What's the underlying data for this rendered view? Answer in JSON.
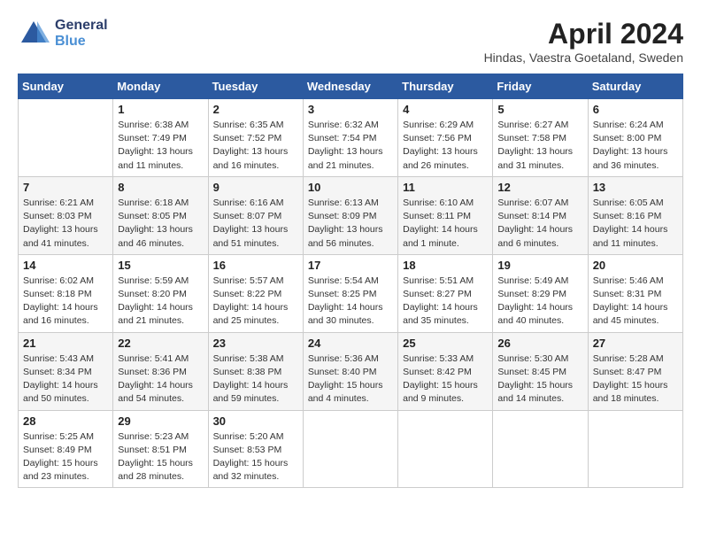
{
  "header": {
    "logo_line1": "General",
    "logo_line2": "Blue",
    "title": "April 2024",
    "location": "Hindas, Vaestra Goetaland, Sweden"
  },
  "weekdays": [
    "Sunday",
    "Monday",
    "Tuesday",
    "Wednesday",
    "Thursday",
    "Friday",
    "Saturday"
  ],
  "weeks": [
    [
      {
        "day": "",
        "info": ""
      },
      {
        "day": "1",
        "info": "Sunrise: 6:38 AM\nSunset: 7:49 PM\nDaylight: 13 hours\nand 11 minutes."
      },
      {
        "day": "2",
        "info": "Sunrise: 6:35 AM\nSunset: 7:52 PM\nDaylight: 13 hours\nand 16 minutes."
      },
      {
        "day": "3",
        "info": "Sunrise: 6:32 AM\nSunset: 7:54 PM\nDaylight: 13 hours\nand 21 minutes."
      },
      {
        "day": "4",
        "info": "Sunrise: 6:29 AM\nSunset: 7:56 PM\nDaylight: 13 hours\nand 26 minutes."
      },
      {
        "day": "5",
        "info": "Sunrise: 6:27 AM\nSunset: 7:58 PM\nDaylight: 13 hours\nand 31 minutes."
      },
      {
        "day": "6",
        "info": "Sunrise: 6:24 AM\nSunset: 8:00 PM\nDaylight: 13 hours\nand 36 minutes."
      }
    ],
    [
      {
        "day": "7",
        "info": "Sunrise: 6:21 AM\nSunset: 8:03 PM\nDaylight: 13 hours\nand 41 minutes."
      },
      {
        "day": "8",
        "info": "Sunrise: 6:18 AM\nSunset: 8:05 PM\nDaylight: 13 hours\nand 46 minutes."
      },
      {
        "day": "9",
        "info": "Sunrise: 6:16 AM\nSunset: 8:07 PM\nDaylight: 13 hours\nand 51 minutes."
      },
      {
        "day": "10",
        "info": "Sunrise: 6:13 AM\nSunset: 8:09 PM\nDaylight: 13 hours\nand 56 minutes."
      },
      {
        "day": "11",
        "info": "Sunrise: 6:10 AM\nSunset: 8:11 PM\nDaylight: 14 hours\nand 1 minute."
      },
      {
        "day": "12",
        "info": "Sunrise: 6:07 AM\nSunset: 8:14 PM\nDaylight: 14 hours\nand 6 minutes."
      },
      {
        "day": "13",
        "info": "Sunrise: 6:05 AM\nSunset: 8:16 PM\nDaylight: 14 hours\nand 11 minutes."
      }
    ],
    [
      {
        "day": "14",
        "info": "Sunrise: 6:02 AM\nSunset: 8:18 PM\nDaylight: 14 hours\nand 16 minutes."
      },
      {
        "day": "15",
        "info": "Sunrise: 5:59 AM\nSunset: 8:20 PM\nDaylight: 14 hours\nand 21 minutes."
      },
      {
        "day": "16",
        "info": "Sunrise: 5:57 AM\nSunset: 8:22 PM\nDaylight: 14 hours\nand 25 minutes."
      },
      {
        "day": "17",
        "info": "Sunrise: 5:54 AM\nSunset: 8:25 PM\nDaylight: 14 hours\nand 30 minutes."
      },
      {
        "day": "18",
        "info": "Sunrise: 5:51 AM\nSunset: 8:27 PM\nDaylight: 14 hours\nand 35 minutes."
      },
      {
        "day": "19",
        "info": "Sunrise: 5:49 AM\nSunset: 8:29 PM\nDaylight: 14 hours\nand 40 minutes."
      },
      {
        "day": "20",
        "info": "Sunrise: 5:46 AM\nSunset: 8:31 PM\nDaylight: 14 hours\nand 45 minutes."
      }
    ],
    [
      {
        "day": "21",
        "info": "Sunrise: 5:43 AM\nSunset: 8:34 PM\nDaylight: 14 hours\nand 50 minutes."
      },
      {
        "day": "22",
        "info": "Sunrise: 5:41 AM\nSunset: 8:36 PM\nDaylight: 14 hours\nand 54 minutes."
      },
      {
        "day": "23",
        "info": "Sunrise: 5:38 AM\nSunset: 8:38 PM\nDaylight: 14 hours\nand 59 minutes."
      },
      {
        "day": "24",
        "info": "Sunrise: 5:36 AM\nSunset: 8:40 PM\nDaylight: 15 hours\nand 4 minutes."
      },
      {
        "day": "25",
        "info": "Sunrise: 5:33 AM\nSunset: 8:42 PM\nDaylight: 15 hours\nand 9 minutes."
      },
      {
        "day": "26",
        "info": "Sunrise: 5:30 AM\nSunset: 8:45 PM\nDaylight: 15 hours\nand 14 minutes."
      },
      {
        "day": "27",
        "info": "Sunrise: 5:28 AM\nSunset: 8:47 PM\nDaylight: 15 hours\nand 18 minutes."
      }
    ],
    [
      {
        "day": "28",
        "info": "Sunrise: 5:25 AM\nSunset: 8:49 PM\nDaylight: 15 hours\nand 23 minutes."
      },
      {
        "day": "29",
        "info": "Sunrise: 5:23 AM\nSunset: 8:51 PM\nDaylight: 15 hours\nand 28 minutes."
      },
      {
        "day": "30",
        "info": "Sunrise: 5:20 AM\nSunset: 8:53 PM\nDaylight: 15 hours\nand 32 minutes."
      },
      {
        "day": "",
        "info": ""
      },
      {
        "day": "",
        "info": ""
      },
      {
        "day": "",
        "info": ""
      },
      {
        "day": "",
        "info": ""
      }
    ]
  ]
}
